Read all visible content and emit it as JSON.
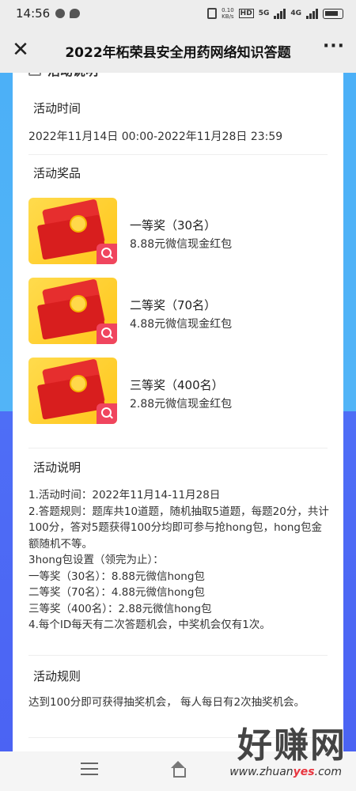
{
  "status_bar": {
    "time": "14:56",
    "net_speed_top": "0.10",
    "net_speed_bottom": "KB/s",
    "hd": "HD",
    "net1": "5G",
    "net2": "4G",
    "battery": "77"
  },
  "app_bar": {
    "title": "2022年柘荣县安全用药网络知识答题",
    "close_icon": "close-icon",
    "more_icon": "more-icon"
  },
  "card": {
    "header_partial": "活动说明"
  },
  "time_section": {
    "title": "活动时间",
    "value": "2022年11月14日 00:00-2022年11月28日 23:59"
  },
  "prizes_section": {
    "title": "活动奖品",
    "items": [
      {
        "name": "一等奖（30名）",
        "desc": "8.88元微信现金红包",
        "coin": "红包"
      },
      {
        "name": "二等奖（70名）",
        "desc": "4.88元微信现金红包",
        "coin": "红包"
      },
      {
        "name": "三等奖（400名）",
        "desc": "2.88元微信现金红包",
        "coin": "红包"
      }
    ]
  },
  "explain_section": {
    "title": "活动说明",
    "lines": [
      "1.活动时间：2022年11月14-11月28日",
      "2.答题规则：题库共10道题，随机抽取5道题，每题20分，共计100分，答对5题获得100分均即可参与抢hong包，hong包金额随机不等。",
      "3hong包设置（领完为止）：",
      "一等奖（30名）：8.88元微信hong包",
      "二等奖（70名）：4.88元微信hong包",
      "三等奖（400名）：2.88元微信hong包",
      "4.每个ID每天有二次答题机会，中奖机会仅有1次。"
    ]
  },
  "rules_section": {
    "title": "活动规则",
    "text": "达到100分即可获得抽奖机会， 每人每日有2次抽奖机会。"
  },
  "watermark": {
    "brand": "好赚网",
    "url_prefix": "www.zhuan",
    "url_accent": "yes",
    "url_suffix": ".com"
  },
  "colors": {
    "bg_top": "#4cb0f7",
    "bg_bottom": "#4b63f3",
    "section_highlight": "#d6ecfb",
    "thumb_bg": "#ffc61a",
    "envelope": "#d81e1e",
    "search_badge": "#f0455e"
  }
}
